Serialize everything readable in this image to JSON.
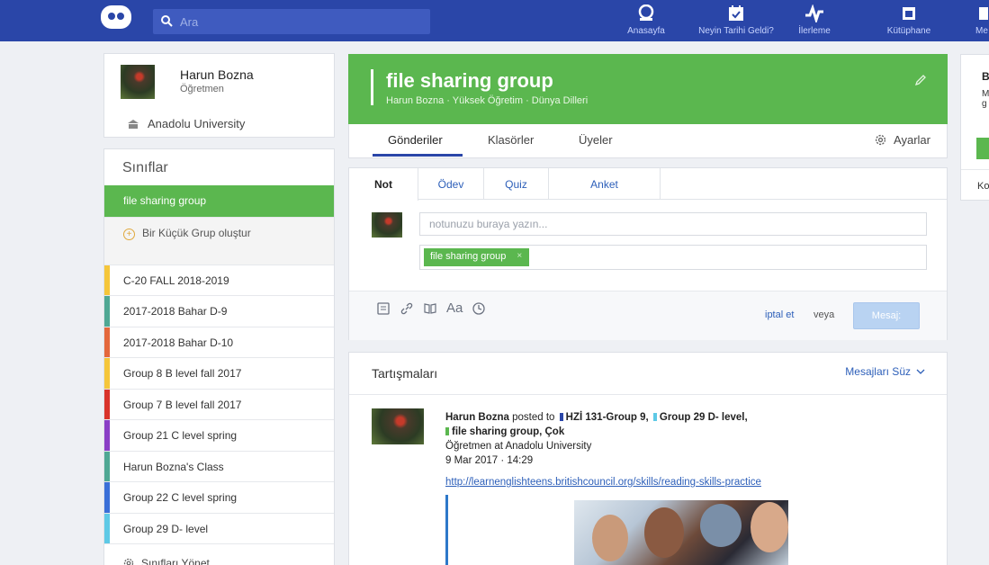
{
  "colors": {
    "topbar": "#2a46a8",
    "accent_green": "#5bb74f",
    "link_blue": "#2d5fb9"
  },
  "search": {
    "placeholder": "Ara"
  },
  "nav": [
    {
      "label": "Anasayfa",
      "icon": "home-icon"
    },
    {
      "label": "Neyin Tarihi Geldi?",
      "icon": "calendar-icon"
    },
    {
      "label": "İlerleme",
      "icon": "pulse-icon"
    },
    {
      "label": "Kütüphane",
      "icon": "library-icon"
    },
    {
      "label": "Me",
      "icon": "messages-icon"
    }
  ],
  "profile": {
    "name": "Harun Bozna",
    "role": "Öğretmen",
    "school": "Anadolu University"
  },
  "classes": {
    "title": "Sınıflar",
    "active": "file sharing group",
    "create_small_group": "Bir Küçük Grup oluştur",
    "items": [
      {
        "name": "C-20 FALL 2018-2019",
        "color": "#f5c63a"
      },
      {
        "name": "2017-2018 Bahar D-9",
        "color": "#4fa894"
      },
      {
        "name": "2017-2018 Bahar D-10",
        "color": "#e4683c"
      },
      {
        "name": "Group 8 B level fall 2017",
        "color": "#f5c63a"
      },
      {
        "name": "Group 7 B level fall 2017",
        "color": "#d9342b"
      },
      {
        "name": "Group 21 C level spring",
        "color": "#8a3fc6"
      },
      {
        "name": "Harun Bozna's Class",
        "color": "#4fa894"
      },
      {
        "name": "Group 22 C level spring",
        "color": "#3a6fd8"
      },
      {
        "name": "Group 29 D- level",
        "color": "#5ec9e6"
      }
    ],
    "manage": "Sınıfları Yönet"
  },
  "group": {
    "title": "file sharing group",
    "subtitle": "Harun Bozna · Yüksek Öğretim · Dünya Dilleri",
    "tabs": [
      "Gönderiler",
      "Klasörler",
      "Üyeler"
    ],
    "settings": "Ayarlar"
  },
  "composer": {
    "tabs": [
      "Not",
      "Ödev",
      "Quiz",
      "Anket"
    ],
    "placeholder": "notunuzu buraya yazın...",
    "recipient": "file sharing group",
    "recipient_remove": "×",
    "format_label": "Aa",
    "cancel": "iptal et",
    "or": "veya",
    "send": "Mesaj:"
  },
  "discussions": {
    "title": "Tartışmaları",
    "filter": "Mesajları Süz",
    "post": {
      "author": "Harun Bozna",
      "posted_to": "posted to",
      "group1": "HZİ 131-Group 9,",
      "group2": "Group 29 D- level,",
      "group3": "file sharing group, Çok",
      "author_meta": "Öğretmen at Anadolu University",
      "date": "9 Mar 2017 · 14:29",
      "link": "http://learnenglishteens.britishcouncil.org/skills/reading-skills-practice"
    }
  },
  "right_card": {
    "title": "B",
    "text_line1": "M",
    "text_line2": "g",
    "footer": "Ko"
  }
}
